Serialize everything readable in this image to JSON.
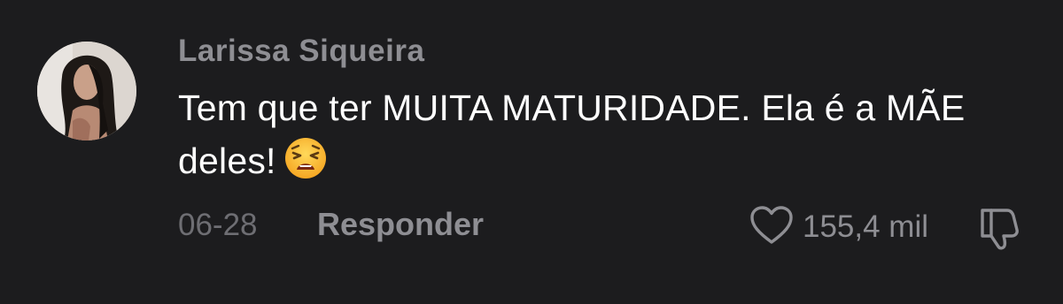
{
  "comment": {
    "author": "Larissa Siqueira",
    "text": "Tem que ter MUITA MATURIDADE. Ela é a MÃE deles!",
    "emoji": "weary-face-emoji",
    "date": "06-28",
    "reply_label": "Responder",
    "likes": "155,4 mil",
    "icons": {
      "like": "heart-icon",
      "dislike": "thumbs-down-icon"
    },
    "colors": {
      "background": "#1c1c1e",
      "text": "#ffffff",
      "muted": "#8e8e93",
      "date": "#6e6e73"
    }
  }
}
